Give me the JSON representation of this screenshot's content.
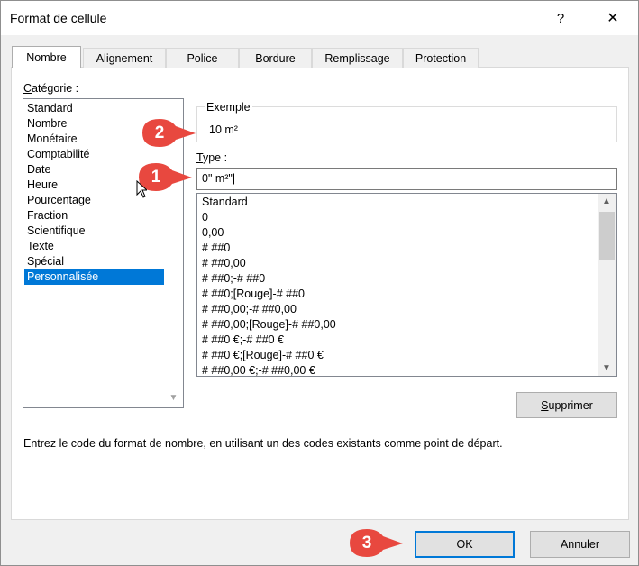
{
  "window": {
    "title": "Format de cellule",
    "help_label": "?",
    "close_label": "✕"
  },
  "tabs": [
    {
      "label": "Nombre",
      "active": true
    },
    {
      "label": "Alignement",
      "active": false
    },
    {
      "label": "Police",
      "active": false
    },
    {
      "label": "Bordure",
      "active": false
    },
    {
      "label": "Remplissage",
      "active": false
    },
    {
      "label": "Protection",
      "active": false
    }
  ],
  "category": {
    "label_first": "C",
    "label_rest": "atégorie :",
    "items": [
      "Standard",
      "Nombre",
      "Monétaire",
      "Comptabilité",
      "Date",
      "Heure",
      "Pourcentage",
      "Fraction",
      "Scientifique",
      "Texte",
      "Spécial",
      "Personnalisée"
    ],
    "selected": "Personnalisée"
  },
  "example": {
    "label": "Exemple",
    "value": "10 m²"
  },
  "type": {
    "label_first": "T",
    "label_rest": "ype :",
    "value": "0\" m²\"|"
  },
  "formats": [
    "Standard",
    "0",
    "0,00",
    "# ##0",
    "# ##0,00",
    "# ##0;-# ##0",
    "# ##0;[Rouge]-# ##0",
    "# ##0,00;-# ##0,00",
    "# ##0,00;[Rouge]-# ##0,00",
    "# ##0 €;-# ##0 €",
    "# ##0 €;[Rouge]-# ##0 €",
    "# ##0,00 €;-# ##0,00 €"
  ],
  "buttons": {
    "delete_first": "S",
    "delete_rest": "upprimer",
    "ok": "OK",
    "cancel": "Annuler"
  },
  "hint": "Entrez le code du format de nombre, en utilisant un des codes existants comme point de départ.",
  "callouts": [
    {
      "number": "1"
    },
    {
      "number": "2"
    },
    {
      "number": "3"
    }
  ],
  "colors": {
    "callout": "#e8483f",
    "selection": "#0078d7"
  }
}
